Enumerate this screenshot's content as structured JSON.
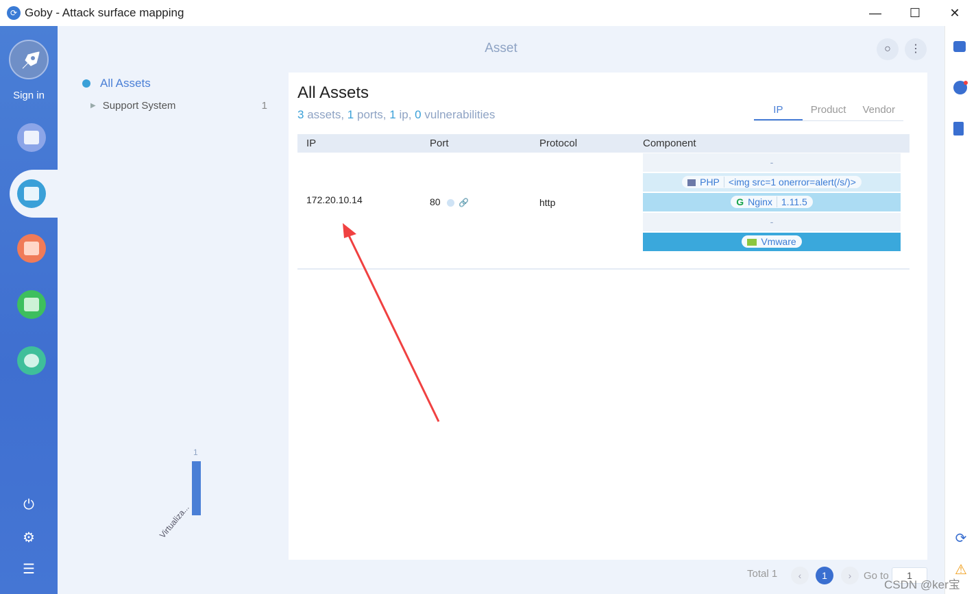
{
  "window": {
    "title": "Goby - Attack surface mapping",
    "minimize": "—",
    "maximize": "☐",
    "close": "✕"
  },
  "sidebar": {
    "signin": "Sign in",
    "nav": [
      {
        "name": "scan",
        "color": "#8ca5e8"
      },
      {
        "name": "asset",
        "color": "#3aa0d8"
      },
      {
        "name": "vulnerability",
        "color": "#f07b58"
      },
      {
        "name": "report",
        "color": "#3dbf5e"
      },
      {
        "name": "extension",
        "color": "#3fbf9a"
      }
    ]
  },
  "header": {
    "title": "Asset"
  },
  "tree": {
    "root": "All Assets",
    "children": [
      {
        "label": "Support System",
        "count": "1"
      }
    ]
  },
  "mini_chart": {
    "value_label": "1",
    "category": "Virtualiza..."
  },
  "panel": {
    "title": "All Assets",
    "summary": {
      "assets": "3",
      "assets_label": "assets,",
      "ports": "1",
      "ports_label": "ports,",
      "ip": "1",
      "ip_label": "ip,",
      "vulns": "0",
      "vulns_label": "vulnerabilities"
    },
    "tabs": [
      "IP",
      "Product",
      "Vendor"
    ],
    "columns": [
      "IP",
      "Port",
      "Protocol",
      "Component"
    ],
    "rows": [
      {
        "ip": "172.20.10.14",
        "port": "80",
        "protocol": "http",
        "components": [
          {
            "type": "dash",
            "text": "-"
          },
          {
            "type": "pill",
            "name": "PHP",
            "version": "<img src=1 onerror=alert(/s/)>"
          },
          {
            "type": "pill",
            "name": "Nginx",
            "version": "1.11.5"
          },
          {
            "type": "dash",
            "text": "-"
          },
          {
            "type": "pill",
            "name": "Vmware",
            "version": ""
          }
        ]
      }
    ]
  },
  "pager": {
    "total": "Total 1",
    "current": "1",
    "goto": "Go to",
    "goto_value": "1"
  },
  "watermark": "CSDN @ker宝"
}
